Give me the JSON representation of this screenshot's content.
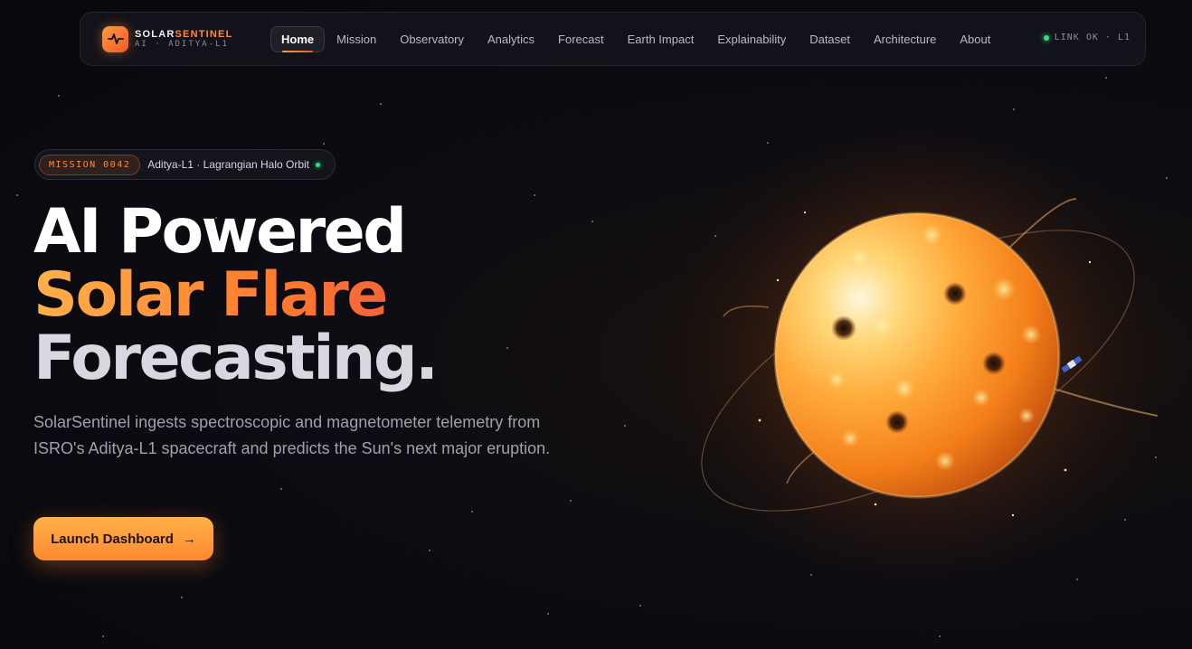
{
  "brand": {
    "name_a": "SOLAR",
    "name_b": "SENTINEL",
    "sub": "AI · ADITYA-L1",
    "logo_icon": "pulse-icon",
    "accent": "#ff8a3a"
  },
  "nav": {
    "items": [
      {
        "label": "Home",
        "active": true
      },
      {
        "label": "Mission"
      },
      {
        "label": "Observatory"
      },
      {
        "label": "Analytics"
      },
      {
        "label": "Forecast"
      },
      {
        "label": "Earth Impact"
      },
      {
        "label": "Explainability"
      },
      {
        "label": "Dataset"
      },
      {
        "label": "Architecture"
      },
      {
        "label": "About"
      }
    ],
    "status": "LINK OK · L1",
    "status_color": "#30e07a"
  },
  "mission": {
    "tag": "MISSION 0042",
    "text": "Aditya-L1 · Lagrangian Halo Orbit"
  },
  "hero": {
    "line1": "AI Powered",
    "line2": "Solar Flare",
    "line3": "Forecasting.",
    "description": "SolarSentinel ingests spectroscopic and magnetometer telemetry from ISRO's Aditya-L1 spacecraft and predicts the Sun's next major eruption.",
    "cta_label": "Launch Dashboard",
    "cta_icon": "arrow-right-icon"
  }
}
